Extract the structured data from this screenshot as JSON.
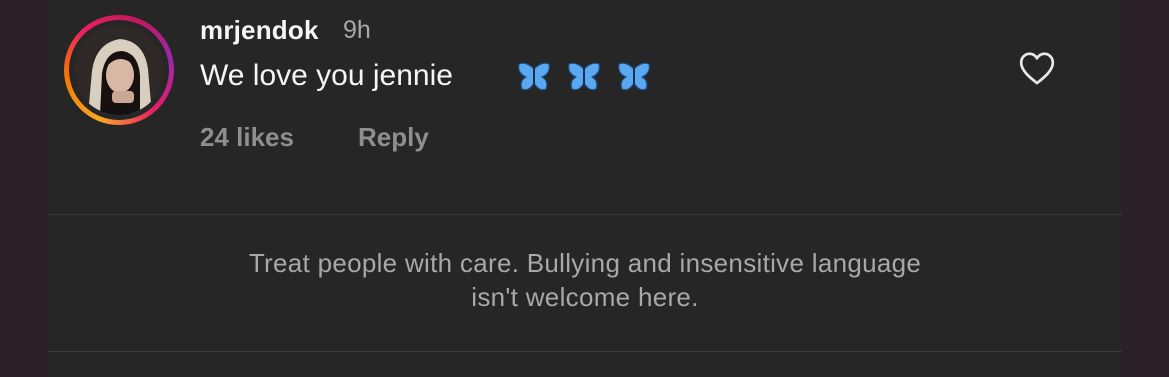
{
  "comment": {
    "username": "mrjendok",
    "timestamp": "9h",
    "text": "We love you jennie",
    "emoji": [
      "butterfly-icon",
      "butterfly-icon",
      "butterfly-icon"
    ],
    "likes": "24 likes",
    "reply_label": "Reply",
    "like_icon": "heart-outline-icon"
  },
  "notice": {
    "line1": "Treat people with care. Bullying and insensitive language",
    "line2": "isn't welcome here."
  },
  "colors": {
    "background": "#262626",
    "frame": "#2b1f28",
    "primary_text": "#f5f5f5",
    "secondary_text": "#a8a8a8",
    "butterfly": "#5aa9f0"
  }
}
